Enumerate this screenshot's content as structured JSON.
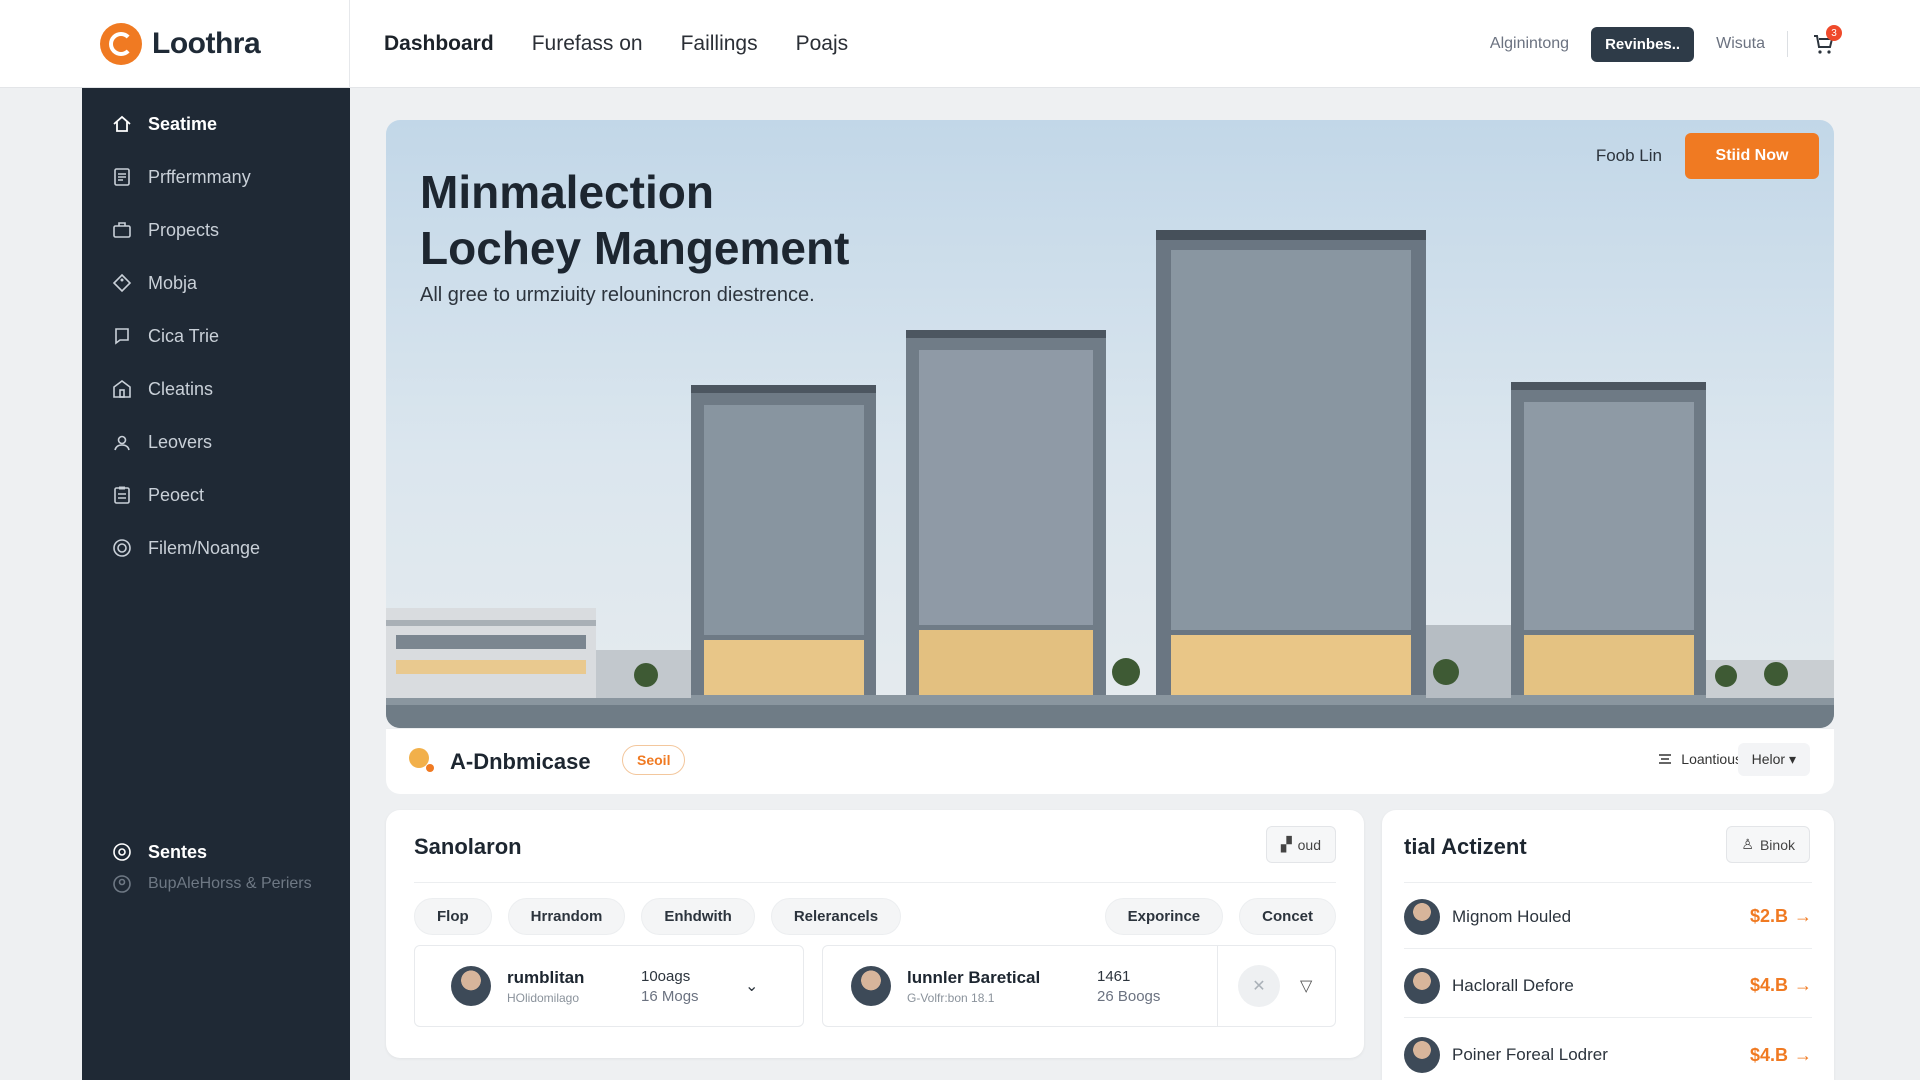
{
  "brand": {
    "name": "Loothra"
  },
  "topnav": {
    "items": [
      "Dashboard",
      "Furefass on",
      "Faillings",
      "Poajs"
    ],
    "right_link": "Alginintong",
    "right_button": "Revinbes..",
    "user": "Wisuta",
    "cart_count": "3"
  },
  "sidebar": {
    "items": [
      {
        "label": "Seatime",
        "icon": "home-icon"
      },
      {
        "label": "Prffermmany",
        "icon": "document-icon"
      },
      {
        "label": "Propects",
        "icon": "briefcase-icon"
      },
      {
        "label": "Mobja",
        "icon": "tag-icon"
      },
      {
        "label": "Cica Trie",
        "icon": "chat-icon"
      },
      {
        "label": "Cleatins",
        "icon": "building-icon"
      },
      {
        "label": "Leovers",
        "icon": "users-icon"
      },
      {
        "label": "Peoect",
        "icon": "clipboard-icon"
      },
      {
        "label": "Filem/Noange",
        "icon": "target-icon"
      }
    ],
    "bottom": [
      {
        "label": "Sentes",
        "icon": "settings-icon"
      },
      {
        "label": "BupAleHorss & Periers",
        "icon": "help-icon"
      }
    ]
  },
  "hero": {
    "title_line1": "Minmalection",
    "title_line2": "Lochey Mangement",
    "subtitle": "All gree to urmziuity relounincron diestrence.",
    "link": "Foob Lin",
    "cta": "Stiid Now"
  },
  "hero_footer": {
    "title": "A-Dnbmicase",
    "badge": "Seoil",
    "right1": "Loantious",
    "right2": "Helor"
  },
  "solution_card": {
    "title": "Sanolaron",
    "button": "oud",
    "chips_left": [
      "Flop",
      "Hrrandom",
      "Enhdwith",
      "Relerancels"
    ],
    "chips_right": [
      "Exporince",
      "Concet"
    ],
    "people": [
      {
        "name": "rumblitan",
        "sub": "HOlidomilago",
        "stat1": "10oags",
        "stat2": "16 Mogs"
      },
      {
        "name": "lunnler Baretical",
        "sub": "G-Volfr:bon 18.1",
        "stat1": "1461",
        "stat2": "26 Boogs"
      }
    ]
  },
  "activity_card": {
    "title": "tial Actizent",
    "button": "Binok",
    "rows": [
      {
        "name": "Mignom Houled",
        "value": "$2.B"
      },
      {
        "name": "Haclorall Defore",
        "value": "$4.B"
      },
      {
        "name": "Poiner Foreal Lodrer",
        "value": "$4.B"
      }
    ]
  },
  "colors": {
    "accent": "#f07a22",
    "sidebar": "#1f2935",
    "button_dark": "#2e3b48"
  }
}
